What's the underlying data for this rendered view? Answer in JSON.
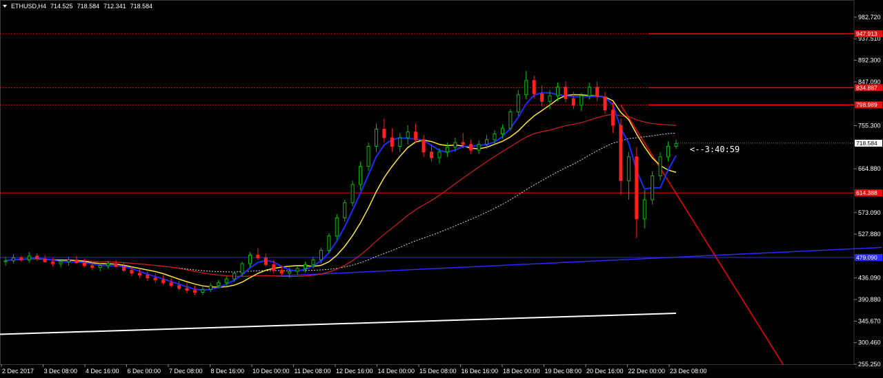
{
  "header": {
    "symbol": "ETHUSD,H4",
    "open": "714.525",
    "high": "718.584",
    "low": "712.341",
    "close": "718.584"
  },
  "countdown": "<--3:40:59",
  "colors": {
    "background": "#000000",
    "bull": "#00c000",
    "bear": "#ff2020",
    "ma_fast": "#1e2cff",
    "ma_mid": "#ffe640",
    "ma_slow": "#d02020",
    "level": "#ff0000",
    "trend_blue": "#2a2aff",
    "price_tag": "#ffffff",
    "level_tag": "#e01010"
  },
  "chart_data": {
    "type": "candlestick",
    "ylim": [
      255.25,
      1010
    ],
    "y_ticks": [
      "982.720",
      "937.510",
      "892.300",
      "847.090",
      "755.300",
      "664.880",
      "573.090",
      "527.880",
      "436.090",
      "390.880",
      "345.670",
      "300.460",
      "255.250"
    ],
    "x_ticks": [
      "2 Dec 2017",
      "3 Dec 08:00",
      "4 Dec 16:00",
      "6 Dec 00:00",
      "7 Dec 08:00",
      "8 Dec 16:00",
      "10 Dec 00:00",
      "11 Dec 08:00",
      "12 Dec 16:00",
      "14 Dec 00:00",
      "15 Dec 08:00",
      "16 Dec 16:00",
      "18 Dec 00:00",
      "19 Dec 08:00",
      "20 Dec 16:00",
      "22 Dec 00:00",
      "23 Dec 08:00"
    ],
    "current_price": "718.584",
    "levels": [
      {
        "value": 947.913,
        "label": "947.913",
        "style": "dotted"
      },
      {
        "value": 834.887,
        "label": "834.887",
        "style": "dotted"
      },
      {
        "value": 798.989,
        "label": "798.989",
        "style": "dotted"
      },
      {
        "value": 614.388,
        "label": "614.388",
        "style": "solid"
      },
      {
        "value": 479.09,
        "label": "479.090",
        "style": "blue"
      }
    ],
    "candles": [
      [
        470,
        480,
        462,
        472
      ],
      [
        472,
        486,
        466,
        478
      ],
      [
        478,
        482,
        470,
        474
      ],
      [
        474,
        490,
        468,
        482
      ],
      [
        482,
        488,
        472,
        476
      ],
      [
        476,
        484,
        468,
        470
      ],
      [
        470,
        478,
        460,
        466
      ],
      [
        466,
        476,
        458,
        470
      ],
      [
        470,
        480,
        462,
        474
      ],
      [
        474,
        482,
        466,
        468
      ],
      [
        468,
        476,
        458,
        462
      ],
      [
        462,
        470,
        452,
        458
      ],
      [
        458,
        468,
        450,
        462
      ],
      [
        462,
        472,
        456,
        466
      ],
      [
        466,
        474,
        458,
        460
      ],
      [
        460,
        468,
        448,
        452
      ],
      [
        452,
        460,
        440,
        446
      ],
      [
        446,
        456,
        436,
        442
      ],
      [
        442,
        450,
        430,
        436
      ],
      [
        436,
        446,
        426,
        432
      ],
      [
        432,
        442,
        422,
        426
      ],
      [
        426,
        436,
        416,
        420
      ],
      [
        420,
        430,
        410,
        414
      ],
      [
        414,
        426,
        404,
        410
      ],
      [
        410,
        420,
        400,
        406
      ],
      [
        406,
        418,
        400,
        412
      ],
      [
        412,
        426,
        406,
        420
      ],
      [
        420,
        432,
        414,
        426
      ],
      [
        426,
        440,
        420,
        434
      ],
      [
        434,
        450,
        428,
        446
      ],
      [
        446,
        470,
        440,
        466
      ],
      [
        466,
        490,
        458,
        484
      ],
      [
        484,
        498,
        474,
        478
      ],
      [
        478,
        488,
        460,
        464
      ],
      [
        464,
        474,
        446,
        452
      ],
      [
        452,
        462,
        440,
        446
      ],
      [
        446,
        458,
        436,
        450
      ],
      [
        450,
        462,
        442,
        456
      ],
      [
        456,
        470,
        448,
        464
      ],
      [
        464,
        480,
        456,
        474
      ],
      [
        474,
        500,
        466,
        494
      ],
      [
        494,
        530,
        488,
        524
      ],
      [
        524,
        570,
        516,
        562
      ],
      [
        562,
        600,
        554,
        594
      ],
      [
        594,
        640,
        586,
        632
      ],
      [
        632,
        680,
        620,
        670
      ],
      [
        670,
        720,
        660,
        712
      ],
      [
        712,
        760,
        700,
        748
      ],
      [
        748,
        770,
        720,
        730
      ],
      [
        730,
        750,
        700,
        712
      ],
      [
        712,
        740,
        700,
        730
      ],
      [
        730,
        756,
        716,
        742
      ],
      [
        742,
        760,
        720,
        726
      ],
      [
        726,
        736,
        690,
        700
      ],
      [
        700,
        716,
        680,
        688
      ],
      [
        688,
        708,
        676,
        700
      ],
      [
        700,
        720,
        690,
        710
      ],
      [
        710,
        730,
        700,
        720
      ],
      [
        720,
        740,
        708,
        716
      ],
      [
        716,
        726,
        696,
        704
      ],
      [
        704,
        724,
        696,
        716
      ],
      [
        716,
        736,
        706,
        726
      ],
      [
        726,
        746,
        716,
        738
      ],
      [
        738,
        758,
        728,
        750
      ],
      [
        750,
        790,
        744,
        784
      ],
      [
        784,
        830,
        776,
        820
      ],
      [
        820,
        870,
        810,
        850
      ],
      [
        850,
        860,
        812,
        822
      ],
      [
        822,
        840,
        796,
        806
      ],
      [
        806,
        830,
        790,
        818
      ],
      [
        818,
        846,
        806,
        836
      ],
      [
        836,
        848,
        804,
        812
      ],
      [
        812,
        826,
        790,
        798
      ],
      [
        798,
        824,
        786,
        818
      ],
      [
        818,
        846,
        810,
        836
      ],
      [
        836,
        848,
        806,
        816
      ],
      [
        816,
        826,
        780,
        788
      ],
      [
        788,
        804,
        740,
        756
      ],
      [
        756,
        770,
        610,
        640
      ],
      [
        640,
        700,
        600,
        690
      ],
      [
        690,
        710,
        520,
        560
      ],
      [
        560,
        620,
        540,
        600
      ],
      [
        600,
        660,
        590,
        650
      ],
      [
        650,
        700,
        640,
        690
      ],
      [
        690,
        722,
        680,
        712
      ],
      [
        712,
        726,
        706,
        718
      ]
    ],
    "ma_fast_label": "",
    "ma_mid_label": "",
    "ma_slow_label": ""
  }
}
